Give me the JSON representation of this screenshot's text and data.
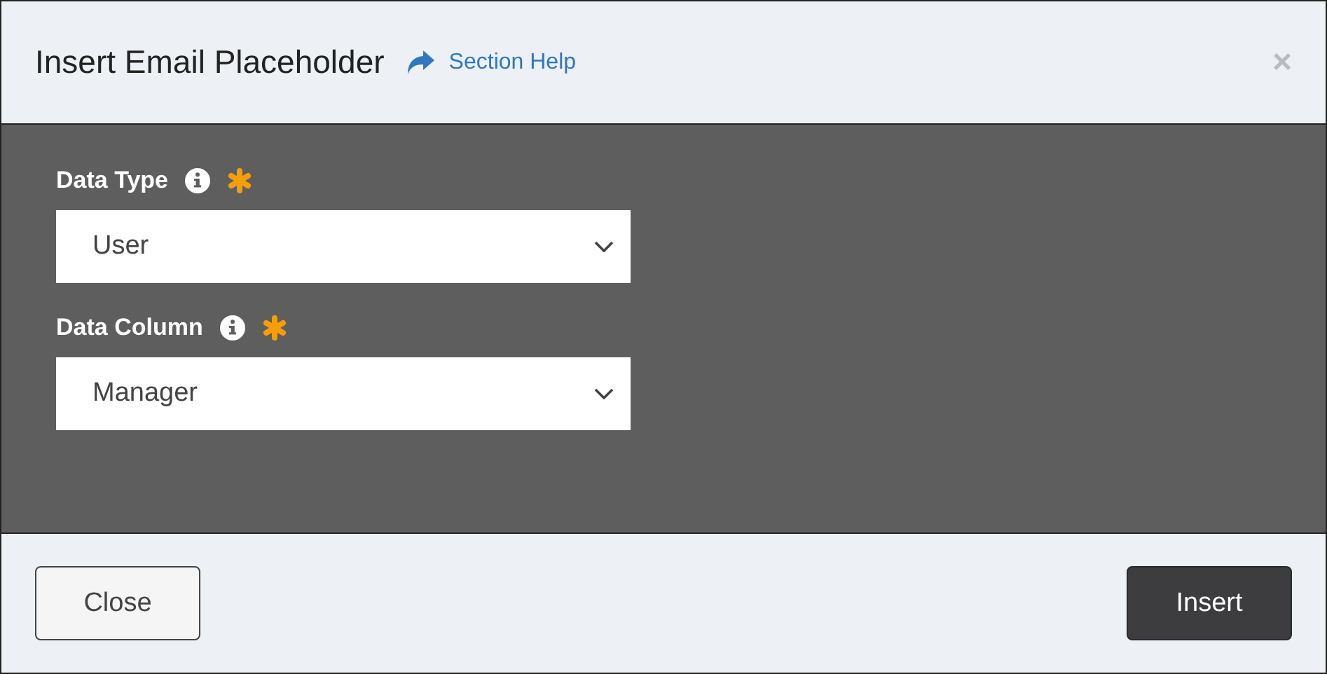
{
  "dialog": {
    "title": "Insert Email Placeholder",
    "help_link": "Section Help",
    "close": "×"
  },
  "fields": [
    {
      "label": "Data Type",
      "required": true,
      "value": "User"
    },
    {
      "label": "Data Column",
      "required": true,
      "value": "Manager"
    }
  ],
  "buttons": [
    {
      "label": "Close",
      "kind": "secondary"
    },
    {
      "label": "Insert",
      "kind": "primary"
    }
  ]
}
